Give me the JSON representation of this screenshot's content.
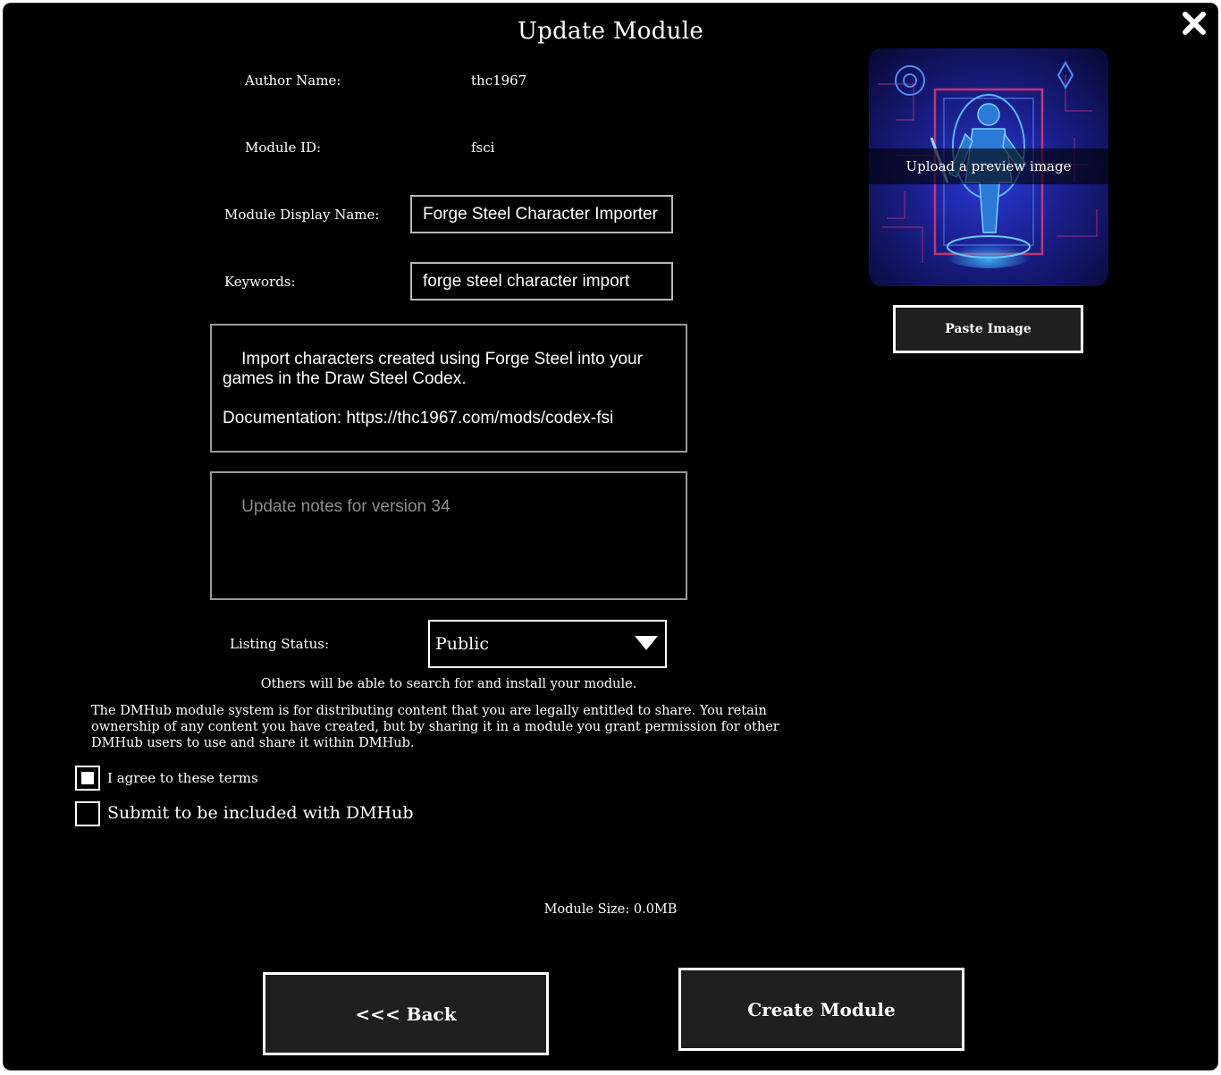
{
  "dialog": {
    "title": "Update Module"
  },
  "fields": {
    "author_label": "Author Name:",
    "author_value": "thc1967",
    "module_id_label": "Module ID:",
    "module_id_value": "fsci",
    "display_name_label": "Module Display Name:",
    "display_name_value": "Forge Steel Character Importer",
    "keywords_label": "Keywords:",
    "keywords_value": "forge steel character import",
    "description_value": "Import characters created using Forge Steel into your\ngames in the Draw Steel Codex.\n\nDocumentation: https://thc1967.com/mods/codex-fsi",
    "update_notes_placeholder": "Update notes for version 34",
    "listing_label": "Listing Status:",
    "listing_value": "Public",
    "listing_info": "Others will be able to search for and install your module."
  },
  "terms": {
    "text": "The DMHub module system is for distributing content that you are legally entitled to share. You retain ownership of any content you have created, but by sharing it in a module you grant permission for other DMHub users to use and share it within DMHub.",
    "agree_label": "I agree to these terms",
    "agree_checked": true,
    "submit_label": "Submit to be included with DMHub",
    "submit_checked": false
  },
  "preview": {
    "upload_label": "Upload a preview image",
    "paste_label": "Paste Image"
  },
  "footer": {
    "module_size": "Module Size: 0.0MB",
    "back_label": "<<< Back",
    "create_label": "Create Module"
  },
  "icons": {
    "close": "close-icon",
    "dropdown": "triangle-down-icon"
  }
}
